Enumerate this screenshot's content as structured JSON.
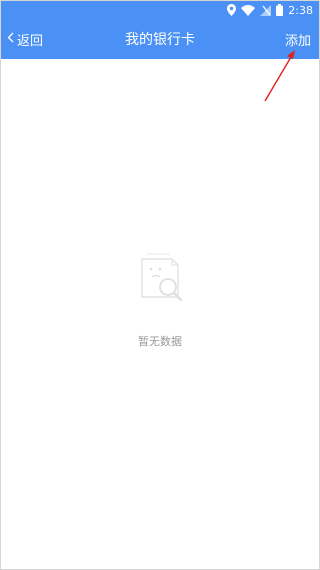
{
  "status_bar": {
    "time": "2:38",
    "icons": [
      "location-icon",
      "wifi-icon",
      "signal-icon",
      "battery-icon"
    ]
  },
  "app_bar": {
    "back_label": "返回",
    "title": "我的银行卡",
    "add_label": "添加",
    "color": "#4a90f5"
  },
  "annotation": {
    "arrow_color": "#e0221b"
  },
  "empty_state": {
    "text": "暂无数据",
    "icon": "empty-document-search-icon"
  }
}
